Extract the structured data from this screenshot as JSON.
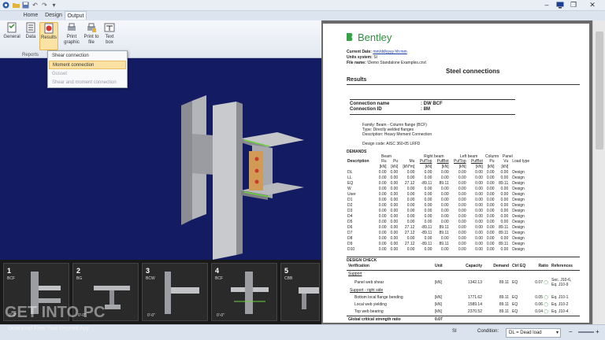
{
  "tabs": [
    {
      "label": "Home"
    },
    {
      "label": "Design"
    },
    {
      "label": "Output"
    }
  ],
  "ribbon": {
    "buttons": [
      {
        "label": "General"
      },
      {
        "label": "Data"
      },
      {
        "label": "Results"
      },
      {
        "label": "Print graphic"
      },
      {
        "label": "Print to file"
      },
      {
        "label": "Text box"
      }
    ],
    "group_label": "Reports"
  },
  "results_menu": {
    "items": [
      {
        "label": "Shear connection",
        "state": "normal"
      },
      {
        "label": "Moment connection",
        "state": "selected"
      },
      {
        "label": "Gusset",
        "state": "disabled"
      },
      {
        "label": "Shear and moment connection",
        "state": "disabled"
      }
    ]
  },
  "thumbnails": [
    {
      "num": "1",
      "code": "BCF",
      "dim": "0'-0\""
    },
    {
      "num": "2",
      "code": "BG",
      "dim": "0'-0\""
    },
    {
      "num": "3",
      "code": "BCW",
      "dim": "0'-0\""
    },
    {
      "num": "4",
      "code": "BCF",
      "dim": "0'-0\""
    },
    {
      "num": "5",
      "code": "CBB",
      "dim": ""
    }
  ],
  "report": {
    "brand": "Bentley",
    "current_date_label": "Current Date:",
    "current_date": "mm/dd/yyyy hh:mm",
    "units_label": "Units system:",
    "units": "SI",
    "file_label": "File name:",
    "file": "\\Demo Standalone Examples.cnx\\",
    "page_title": "Steel connections",
    "section_results": "Results",
    "connection_name_label": "Connection name",
    "connection_name": "DW BCF",
    "connection_id_label": "Connection ID",
    "connection_id": "8M",
    "family": "Family: Beam - Column flange (BCF)",
    "type": "Type: Directly welded flanges",
    "description": "Description: Heavy Moment Connection",
    "design_code": "Design code: AISC 360-05 LRFD",
    "demands_title": "DEMANDS",
    "demand_group_headers": [
      "Beam",
      "Right beam",
      "Left beam",
      "Column",
      "Panel"
    ],
    "demand_headers": [
      "Description",
      "Ru",
      "Pu",
      "Mu",
      "PufTop",
      "PufBot",
      "PufTop",
      "PufBot",
      "Pu",
      "Vu",
      "Load type"
    ],
    "demand_units": [
      "",
      "[kN]",
      "[kN]",
      "[kN*m]",
      "[kN]",
      "[kN]",
      "[kN]",
      "[kN]",
      "[kN]",
      "[kN]",
      ""
    ],
    "demand_rows": [
      [
        "DL",
        "0.00",
        "0.00",
        "0.00",
        "0.00",
        "0.00",
        "0.00",
        "0.00",
        "0.00",
        "0.00",
        "Design"
      ],
      [
        "LL",
        "0.00",
        "0.00",
        "0.00",
        "0.00",
        "0.00",
        "0.00",
        "0.00",
        "0.00",
        "0.00",
        "Design"
      ],
      [
        "EQ",
        "0.00",
        "0.00",
        "27.12",
        "-89.11",
        "89.11",
        "0.00",
        "0.00",
        "0.00",
        "89.11",
        "Design"
      ],
      [
        "W",
        "0.00",
        "0.00",
        "0.00",
        "0.00",
        "0.00",
        "0.00",
        "0.00",
        "0.00",
        "0.00",
        "Design"
      ],
      [
        "User",
        "0.00",
        "0.00",
        "0.00",
        "0.00",
        "0.00",
        "0.00",
        "0.00",
        "0.00",
        "0.00",
        "Design"
      ],
      [
        "D1",
        "0.00",
        "0.00",
        "0.00",
        "0.00",
        "0.00",
        "0.00",
        "0.00",
        "0.00",
        "0.00",
        "Design"
      ],
      [
        "D2",
        "0.00",
        "0.00",
        "0.00",
        "0.00",
        "0.00",
        "0.00",
        "0.00",
        "0.00",
        "0.00",
        "Design"
      ],
      [
        "D3",
        "0.00",
        "0.00",
        "0.00",
        "0.00",
        "0.00",
        "0.00",
        "0.00",
        "0.00",
        "0.00",
        "Design"
      ],
      [
        "D4",
        "0.00",
        "0.00",
        "0.00",
        "0.00",
        "0.00",
        "0.00",
        "0.00",
        "0.00",
        "0.00",
        "Design"
      ],
      [
        "D5",
        "0.00",
        "0.00",
        "0.00",
        "0.00",
        "0.00",
        "0.00",
        "0.00",
        "0.00",
        "0.00",
        "Design"
      ],
      [
        "D6",
        "0.00",
        "0.00",
        "27.12",
        "-89.11",
        "89.11",
        "0.00",
        "0.00",
        "0.00",
        "89.11",
        "Design"
      ],
      [
        "D7",
        "0.00",
        "0.00",
        "27.12",
        "-89.11",
        "89.11",
        "0.00",
        "0.00",
        "0.00",
        "89.11",
        "Design"
      ],
      [
        "D8",
        "0.00",
        "0.00",
        "0.00",
        "0.00",
        "0.00",
        "0.00",
        "0.00",
        "0.00",
        "0.00",
        "Design"
      ],
      [
        "D9",
        "0.00",
        "0.00",
        "27.12",
        "-89.11",
        "89.11",
        "0.00",
        "0.00",
        "0.00",
        "89.11",
        "Design"
      ],
      [
        "D10",
        "0.00",
        "0.00",
        "0.00",
        "0.00",
        "0.00",
        "0.00",
        "0.00",
        "0.00",
        "0.00",
        "Design"
      ]
    ],
    "check_title": "DESIGN CHECK",
    "check_headers": [
      "Verification",
      "Unit",
      "Capacity",
      "Demand",
      "Ctrl EQ",
      "Ratio",
      "References"
    ],
    "support_label": "Support",
    "panel_row": [
      "Panel web shear",
      "[kN]",
      "1342.13",
      "89.11",
      "EQ",
      "0.07",
      "Sec. J10-6, Eq. J10-9"
    ],
    "right_side_label": "Support - right side",
    "right_rows": [
      [
        "Bottom local flange bending",
        "[kN]",
        "1771.62",
        "89.11",
        "EQ",
        "0.05",
        "Eq. J10-1"
      ],
      [
        "Local web yielding",
        "[kN]",
        "1589.14",
        "89.11",
        "EQ",
        "0.06",
        "Eq. J10-2"
      ],
      [
        "Top web bearing",
        "[kN]",
        "2370.52",
        "89.11",
        "EQ",
        "0.04",
        "Eq. J10-4"
      ]
    ],
    "global_label": "Global critical strength ratio",
    "global_value": "0.07"
  },
  "statusbar": {
    "units": "SI",
    "condition_label": "Condition:",
    "condition_value": "DL = Dead load"
  },
  "watermark": "GET INTO PC",
  "watermark_sub": "Download Free Your Desired App",
  "colors": {
    "viewport_bg": "#131b63",
    "accent": "#fbe2a4",
    "report_bg": "#ffffff"
  }
}
